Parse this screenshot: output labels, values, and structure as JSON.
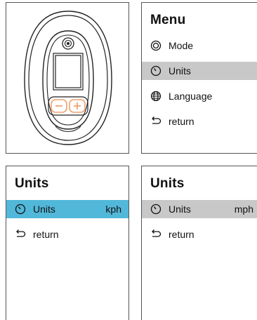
{
  "menu": {
    "title": "Menu",
    "items": [
      {
        "label": "Mode",
        "icon": "mode-icon"
      },
      {
        "label": "Units",
        "icon": "gauge-icon",
        "selected": true
      },
      {
        "label": "Language",
        "icon": "globe-icon"
      },
      {
        "label": "return",
        "icon": "return-arrow-icon"
      }
    ]
  },
  "units_kph": {
    "title": "Units",
    "selected_row": {
      "label": "Units",
      "value": "kph",
      "icon": "gauge-icon"
    },
    "return_label": "return"
  },
  "units_mph": {
    "title": "Units",
    "selected_row": {
      "label": "Units",
      "value": "mph",
      "icon": "gauge-icon"
    },
    "return_label": "return"
  },
  "colors": {
    "highlight_blue": "#52b8da",
    "highlight_gray": "#c8c8c8",
    "button_accent": "#f0a070"
  }
}
